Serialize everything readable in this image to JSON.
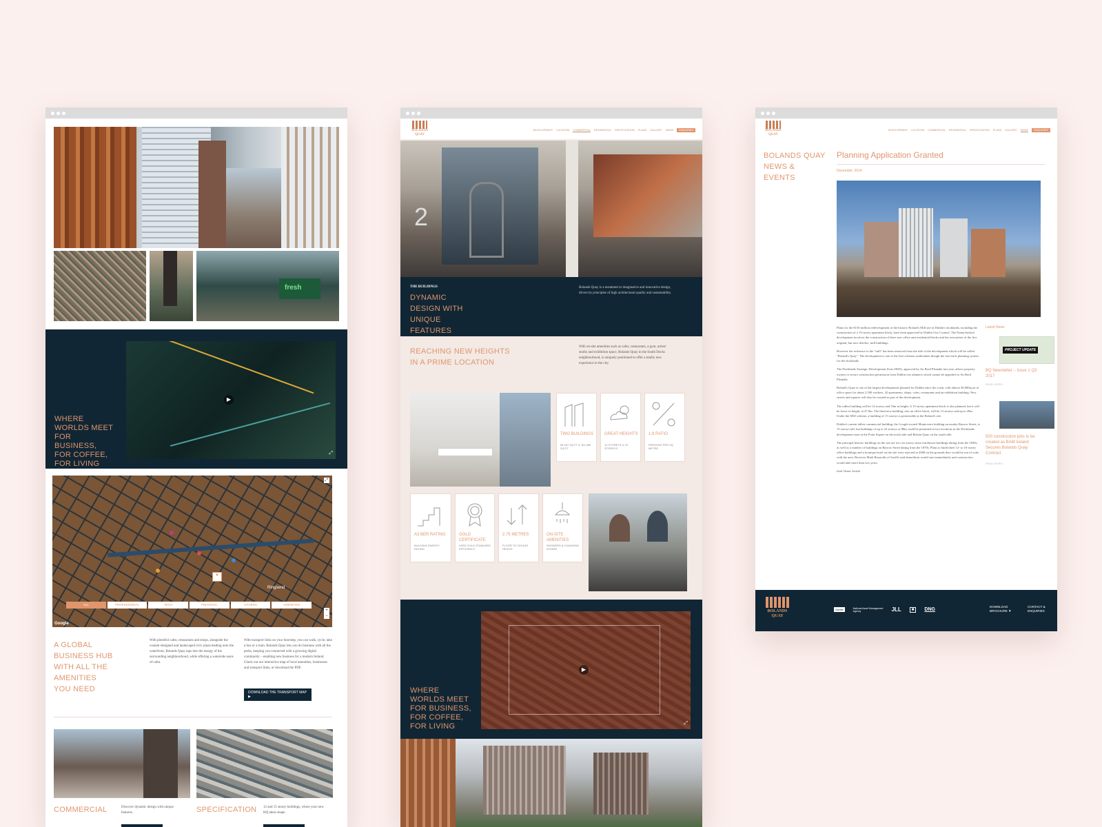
{
  "colors": {
    "page_bg": "#fcf0ee",
    "navy": "#102634",
    "accent": "#e0956c",
    "copper": "#b36a3a"
  },
  "left": {
    "hero_caption": "WHERE WORLDS MEET FOR BUSINESS, FOR COFFEE, FOR LIVING",
    "map_filters": [
      "ALL",
      "PROFESSIONAL",
      "TECH",
      "FINANCIAL",
      "OTHERS",
      "AMENITIES"
    ],
    "map_street_label": "Ringsend",
    "map_brand": "Google",
    "hub_heading": "A GLOBAL BUSINESS HUB WITH ALL THE AMENITIES YOU NEED",
    "hub_text_1": "With plentiful cafes, restaurants and shops, alongside the custom-designed and landscaped civic plaza leading onto the waterfront, Bolands Quay taps into the energy of the surrounding neighbourhood, while offering a waterside oasis of calm.",
    "hub_text_2": "With transport links on your doorstep, you can walk, cycle, take a bus or a train. Bolands Quay lets you do business with all the perks, keeping you connected with a growing digital community – enabling new business for a modern Ireland. Check out our interactive map of local amenities, businesses and transport links, or download the PDF.",
    "hub_button": "DOWNLOAD THE TRANSPORT MAP",
    "card_1_title": "COMMERCIAL",
    "card_1_text": "Discover dynamic design with unique features.",
    "card_2_title": "SPECIFICATION",
    "card_2_text": "12 and 15 storey buildings, where your new HQ takes shape."
  },
  "middle": {
    "logo": "BOLANDS QUAY",
    "nav": [
      "DEVELOPMENT",
      "LOCATION",
      "COMMERCIAL",
      "RESIDENTIAL",
      "SPECIFICATION",
      "PLANS",
      "GALLERY",
      "NEWS"
    ],
    "nav_cta": "ENQUIRIES",
    "eyebrow": "THE BUILDINGS",
    "headline": "DYNAMIC DESIGN WITH UNIQUE FEATURES",
    "headline_text": "Bolands Quay is a testament to imaginative and innovative design, driven by principles of high architectural quality and sustainability.",
    "section_heading": "REACHING NEW HEIGHTS IN A PRIME LOCATION",
    "section_text": "With on-site amenities such as cafes, restaurants, a gym, artists' studio and exhibition space, Bolands Quay in the South Docks neighbourhood, is uniquely positioned to offer a totally new experience in the city.",
    "features_row_1": [
      {
        "title": "TWO BUILDINGS",
        "sub": "85,187 SQ FT & 102,465 SQ FT",
        "icon": "buildings-icon"
      },
      {
        "title": "GREAT HEIGHTS",
        "sub": "12 STOREYS & 15 STOREYS",
        "icon": "weather-icon"
      },
      {
        "title": "1:8 RATIO",
        "sub": "PERSONS PER SQ METRE",
        "icon": "percent-icon"
      }
    ],
    "features_row_2": [
      {
        "title": "A3 BER RATING",
        "sub": "BUILDING ENERGY RATING",
        "icon": "bar-chart-icon"
      },
      {
        "title": "GOLD CERTIFICATE",
        "sub": "LEED GOLD STANDARD EFFICIENCY",
        "icon": "award-icon"
      },
      {
        "title": "2.75 METRES",
        "sub": "FLOOR TO CEILING HEIGHT",
        "icon": "arrows-icon"
      },
      {
        "title": "ON-SITE AMENITIES",
        "sub": "SHOWERS & CHANGING ROOMS",
        "icon": "shower-icon"
      }
    ],
    "video_caption": "WHERE WORLDS MEET FOR BUSINESS, FOR COFFEE, FOR LIVING"
  },
  "right": {
    "logo": "BOLANDS QUAY",
    "nav": [
      "DEVELOPMENT",
      "LOCATION",
      "COMMERCIAL",
      "RESIDENTIAL",
      "SPECIFICATION",
      "PLANS",
      "GALLERY",
      "NEWS"
    ],
    "nav_cta": "ENQUIRIES",
    "side_title": "BOLANDS QUAY NEWS & EVENTS",
    "article_title": "Planning Application Granted",
    "article_date": "December, 2014",
    "article_paragraphs": [
      "Plans for the €150 million redevelopment of the historic Boland's Mill site in Dublin's docklands, including the construction of a 15-storey apartment block, have been approved by Dublin City Council. The Nama-backed development involves the construction of three new office and residential blocks and the restoration of the five original, but now derelict, mill buildings.",
      "However the reference to the \"mill\" has been removed from the title of the development which will be called \"Boland's Quay\". The development is one of the first schemes undertaken though the fast-track planning system for the docklands.",
      "The Docklands Strategic Development Zone (SDZ), approved by An Bord Pleanála last year, allows property owners to secure construction permission from Dublin city planners which cannot be appealed to An Bord Pleanála.",
      "Boland's Quay is one of the largest developments planned for Dublin since the crash, with almost 30,000sq m of office space for about 2,500 workers, 42 apartments, shops, cafes, restaurants and an exhibition building. New streets and squares will also be created as part of the development.",
      "The tallest building will be 14 storeys and 53m in height. A 15-storey apartment block is also planned, but it will be lower in height, at 47.8m. The third new building, also an office block, will be 13 storeys and up to 49m. Under the SDZ scheme, a building of 15 storeys is permissible at the Boland's site.",
      "Dublin's current tallest commercial building, the Google-owned Montevetro building on nearby Barrow Street, is 15 storeys tall, but buildings of up to 22 storeys or 88m could be permitted at two locations in the Docklands development zone at the Point Square on the north side and Britain Quay on the south side.",
      "The principal historic buildings on the site are two six-storey stone warehouse buildings dating from the 1830s, as well as a number of buildings on Barrow Street dating from the 1870s. Plans to build three 12- to 16-storey office buildings and a boutique hotel on the site were rejected in 2008 on the grounds they would be out of scale with the area. Receiver Mark Reynolds of Savills said demolition would start immediately and construction would take more than two years."
    ],
    "article_source": "Irish Times Article",
    "latest_label": "Latest News",
    "latest": [
      {
        "title": "BQ Newsletter – Issue 1 Q3 2017",
        "more": "READ MORE ›",
        "thumb_text": "PROJECT UPDATE"
      },
      {
        "title": "500 construction jobs to be created as BAM Ireland Secures Bolands Quay Contract",
        "more": "READ MORE ›"
      }
    ],
    "footer_logo": "BOLANDS QUAY",
    "footer_partners": [
      "Savills",
      "National Asset Management Agency",
      "JLL",
      "■",
      "DNG"
    ],
    "footer_download": "DOWNLOAD BROCHURE",
    "footer_contact": "CONTACT & ENQUIRIES"
  }
}
